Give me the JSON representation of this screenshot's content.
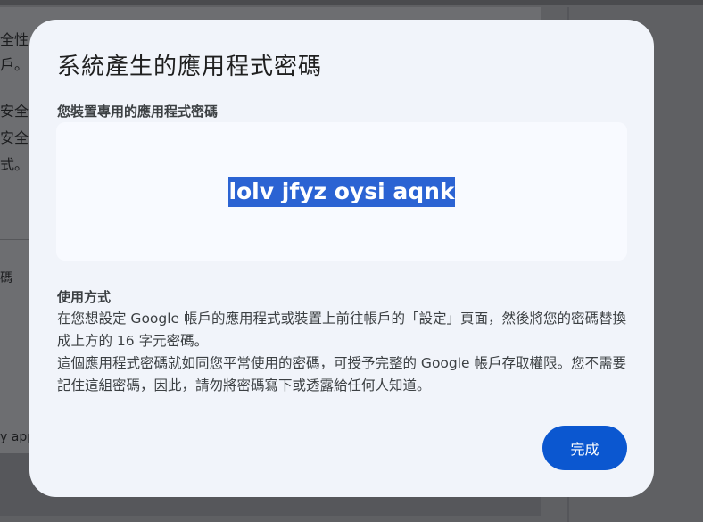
{
  "background": {
    "text_lines": [
      "全性",
      "戶。",
      "安全",
      "安全",
      "式。"
    ],
    "row_label": "碼",
    "bottom_label": "y app"
  },
  "dialog": {
    "title": "系統產生的應用程式密碼",
    "password_label": "您裝置專用的應用程式密碼",
    "password": "lolv jfyz oysi aqnk",
    "usage_heading": "使用方式",
    "usage_paragraph_1": "在您想設定 Google 帳戶的應用程式或裝置上前往帳戶的「設定」頁面，然後將您的密碼替換成上方的 16 字元密碼。",
    "usage_paragraph_2": "這個應用程式密碼就如同您平常使用的密碼，可授予完整的 Google 帳戶存取權限。您不需要記住這組密碼，因此，請勿將密碼寫下或透露給任何人知道。",
    "done_label": "完成"
  },
  "colors": {
    "dialog_bg": "#f1f4fa",
    "password_highlight": "#2b63d3",
    "primary_button": "#0b57d0",
    "scrim": "#5f6063"
  }
}
